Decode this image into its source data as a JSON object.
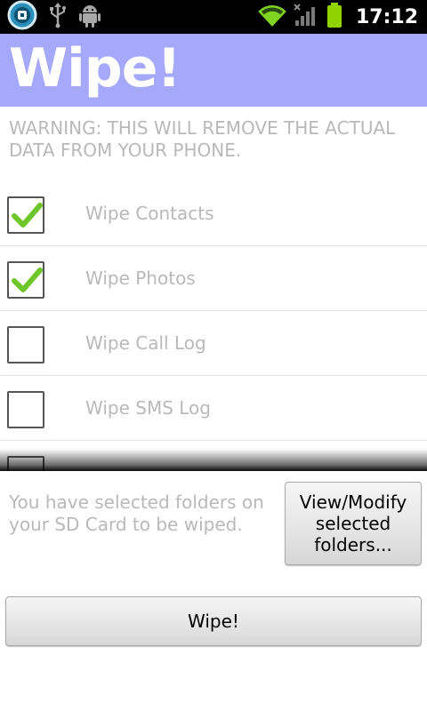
{
  "status_bar": {
    "time": "17:12",
    "icons": [
      "app-notification-icon",
      "usb-icon",
      "android-debug-icon",
      "wifi-icon",
      "signal-icon",
      "battery-icon"
    ],
    "battery_color": "#8fd400"
  },
  "title_bar": {
    "title": "Wipe!",
    "background_color": "#a5a8fb"
  },
  "warning": "WARNING: THIS WILL REMOVE THE ACTUAL DATA FROM YOUR PHONE.",
  "options": [
    {
      "label": "Wipe Contacts",
      "checked": true
    },
    {
      "label": "Wipe Photos",
      "checked": true
    },
    {
      "label": "Wipe Call Log",
      "checked": false
    },
    {
      "label": "Wipe SMS Log",
      "checked": false
    },
    {
      "label": "",
      "checked": false
    }
  ],
  "sd_card_message": "You have selected folders on your SD Card to be wiped.",
  "buttons": {
    "view_modify": "View/Modify selected folders...",
    "wipe": "Wipe!"
  },
  "colors": {
    "check_green": "#6fc62a",
    "muted_text": "#b9b9b9"
  }
}
